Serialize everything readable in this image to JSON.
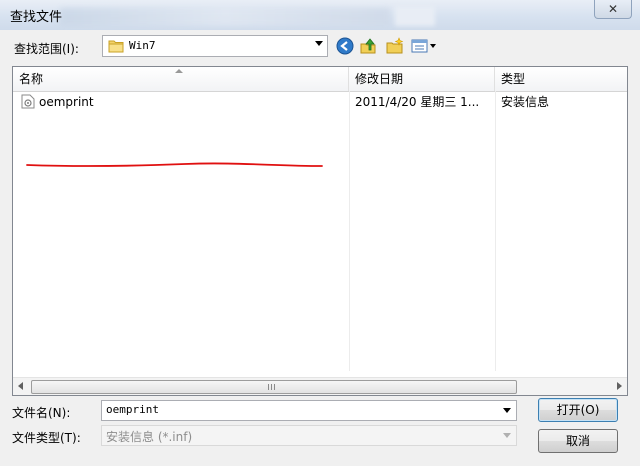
{
  "window": {
    "title": "查找文件",
    "close_glyph": "✕"
  },
  "toolbar": {
    "look_in_label": "查找范围(I):",
    "look_in_value": "Win7",
    "icons": [
      "back-icon",
      "up-folder-icon",
      "new-folder-icon",
      "view-menu-icon"
    ]
  },
  "file_list": {
    "columns": [
      "名称",
      "修改日期",
      "类型"
    ],
    "rows": [
      {
        "name": "oemprint",
        "modified": "2011/4/20 星期三 1...",
        "type": "安装信息"
      }
    ],
    "scroll_grip": "|||"
  },
  "footer": {
    "filename_label": "文件名(N):",
    "filename_value": "oemprint",
    "filetype_label": "文件类型(T):",
    "filetype_value": "安装信息 (*.inf)",
    "open_button": "打开(O)",
    "cancel_button": "取消"
  },
  "colors": {
    "annotation_red": "#e01010",
    "accent_blue": "#3c7fb1"
  }
}
